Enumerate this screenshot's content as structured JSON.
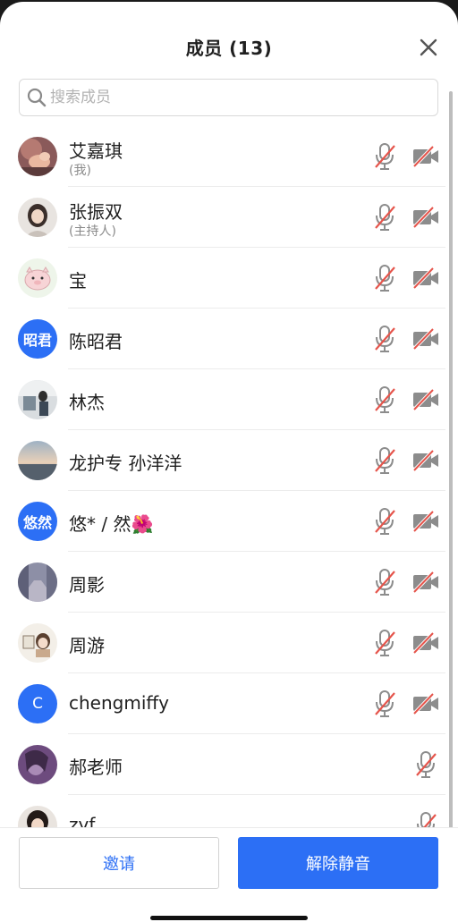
{
  "header": {
    "title": "成员 (13)"
  },
  "search": {
    "placeholder": "搜索成员"
  },
  "members": [
    {
      "name": "艾嘉琪",
      "sub": "(我)",
      "avatar": "photo-hands",
      "mic": "muted",
      "cam": "off"
    },
    {
      "name": "张振双",
      "sub": "(主持人)",
      "avatar": "photo-girl",
      "mic": "muted",
      "cam": "off"
    },
    {
      "name": "宝",
      "avatar": "photo-pig",
      "mic": "muted",
      "cam": "off"
    },
    {
      "name": "陈昭君",
      "avatar_text": "昭君",
      "avatar": "initials",
      "mic": "muted",
      "cam": "off"
    },
    {
      "name": "林杰",
      "avatar": "photo-room",
      "mic": "muted",
      "cam": "off"
    },
    {
      "name": "龙护专 孙洋洋",
      "avatar": "photo-sunset",
      "mic": "muted",
      "cam": "off"
    },
    {
      "name": "悠* /  然🌺",
      "avatar_text": "悠然",
      "avatar": "initials",
      "mic": "muted",
      "cam": "off"
    },
    {
      "name": "周影",
      "avatar": "photo-street",
      "mic": "muted",
      "cam": "off"
    },
    {
      "name": "周游",
      "avatar": "photo-cartoon",
      "mic": "muted",
      "cam": "off"
    },
    {
      "name": "chengmiffy",
      "avatar_text": "C",
      "avatar": "initials",
      "mic": "muted",
      "cam": "off"
    },
    {
      "name": "郝老师",
      "avatar": "photo-purple",
      "mic": "muted"
    },
    {
      "name": "zyf",
      "avatar": "photo-dark",
      "mic": "muted"
    }
  ],
  "footer": {
    "invite_label": "邀请",
    "unmute_label": "解除静音"
  },
  "colors": {
    "accent": "#2c6ff5",
    "muted_slash": "#e5544b",
    "icon_gray": "#8c8c8c"
  }
}
